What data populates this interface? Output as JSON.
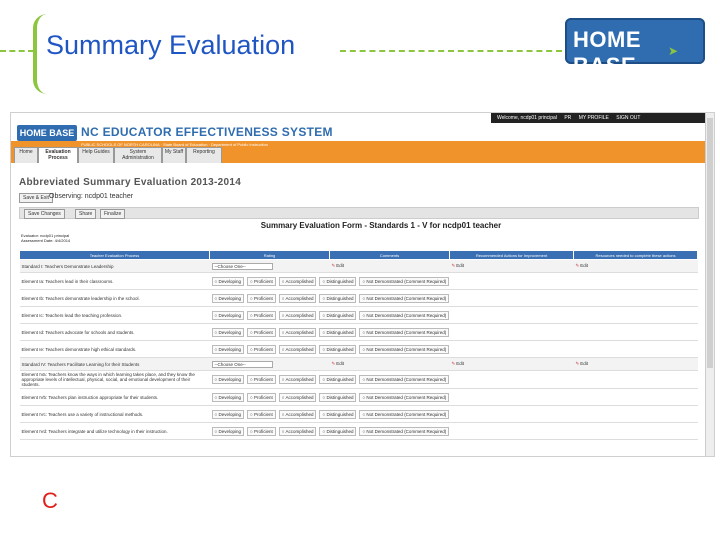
{
  "slide": {
    "title": "Summary Evaluation",
    "logo_text": "HOME BASE",
    "footer_letter": "C"
  },
  "app": {
    "welcome": "Welcome, ncdp01 principal",
    "top_links": [
      "PR",
      "MY PROFILE",
      "SIGN OUT"
    ],
    "logo_text": "HOME BASE",
    "system_title": "NC EDUCATOR EFFECTIVENESS SYSTEM",
    "subtitle": "PUBLIC SCHOOLS OF NORTH CAROLINA · State Board of Education · Department of Public Instruction",
    "tabs": [
      "Home",
      "Evaluation Process",
      "Help Guides",
      "System Administration",
      "My Staff",
      "Reporting"
    ],
    "page_title": "Abbreviated Summary Evaluation 2013-2014",
    "save_exit": "Save & Exit",
    "observing": "Observing: ncdp01 teacher",
    "toolbar": [
      "Save Changes",
      "Share",
      "Finalize"
    ],
    "form_title": "Summary Evaluation Form - Standards 1 - V for ncdp01 teacher",
    "evaluator": "Evaluator: ncdp01 principal",
    "assessment_date": "Assessment Date: 4/4/2014",
    "columns": [
      "Teacher Evaluation Process",
      "Rating",
      "Comments",
      "Recommended Actions for Improvement",
      "Resources needed to complete these actions"
    ],
    "rating_options": [
      "Developing",
      "Proficient",
      "Accomplished",
      "Distinguished",
      "Not Demonstrated (Comment Required)"
    ],
    "choose_label": "--Choose One--",
    "edit_label": "Edit",
    "rows": [
      {
        "type": "standard",
        "text": "Standard I: Teachers Demonstrate Leadership"
      },
      {
        "type": "element",
        "text": "Element Ia: Teachers lead in their classrooms."
      },
      {
        "type": "element",
        "text": "Element Ib: Teachers demonstrate leadership in the school."
      },
      {
        "type": "element",
        "text": "Element Ic: Teachers lead the teaching profession."
      },
      {
        "type": "element",
        "text": "Element Id: Teachers advocate for schools and students."
      },
      {
        "type": "element",
        "text": "Element Ie: Teachers demonstrate high ethical standards."
      },
      {
        "type": "standard",
        "text": "Standard IV: Teachers Facilitate Learning for their Students"
      },
      {
        "type": "element",
        "text": "Element IVa: Teachers know the ways in which learning takes place, and they know the appropriate levels of intellectual, physical, social, and emotional development of their students."
      },
      {
        "type": "element",
        "text": "Element IVb: Teachers plan instruction appropriate for their students."
      },
      {
        "type": "element",
        "text": "Element IVc: Teachers use a variety of instructional methods."
      },
      {
        "type": "element",
        "text": "Element IVd: Teachers integrate and utilize technology in their instruction."
      }
    ]
  }
}
